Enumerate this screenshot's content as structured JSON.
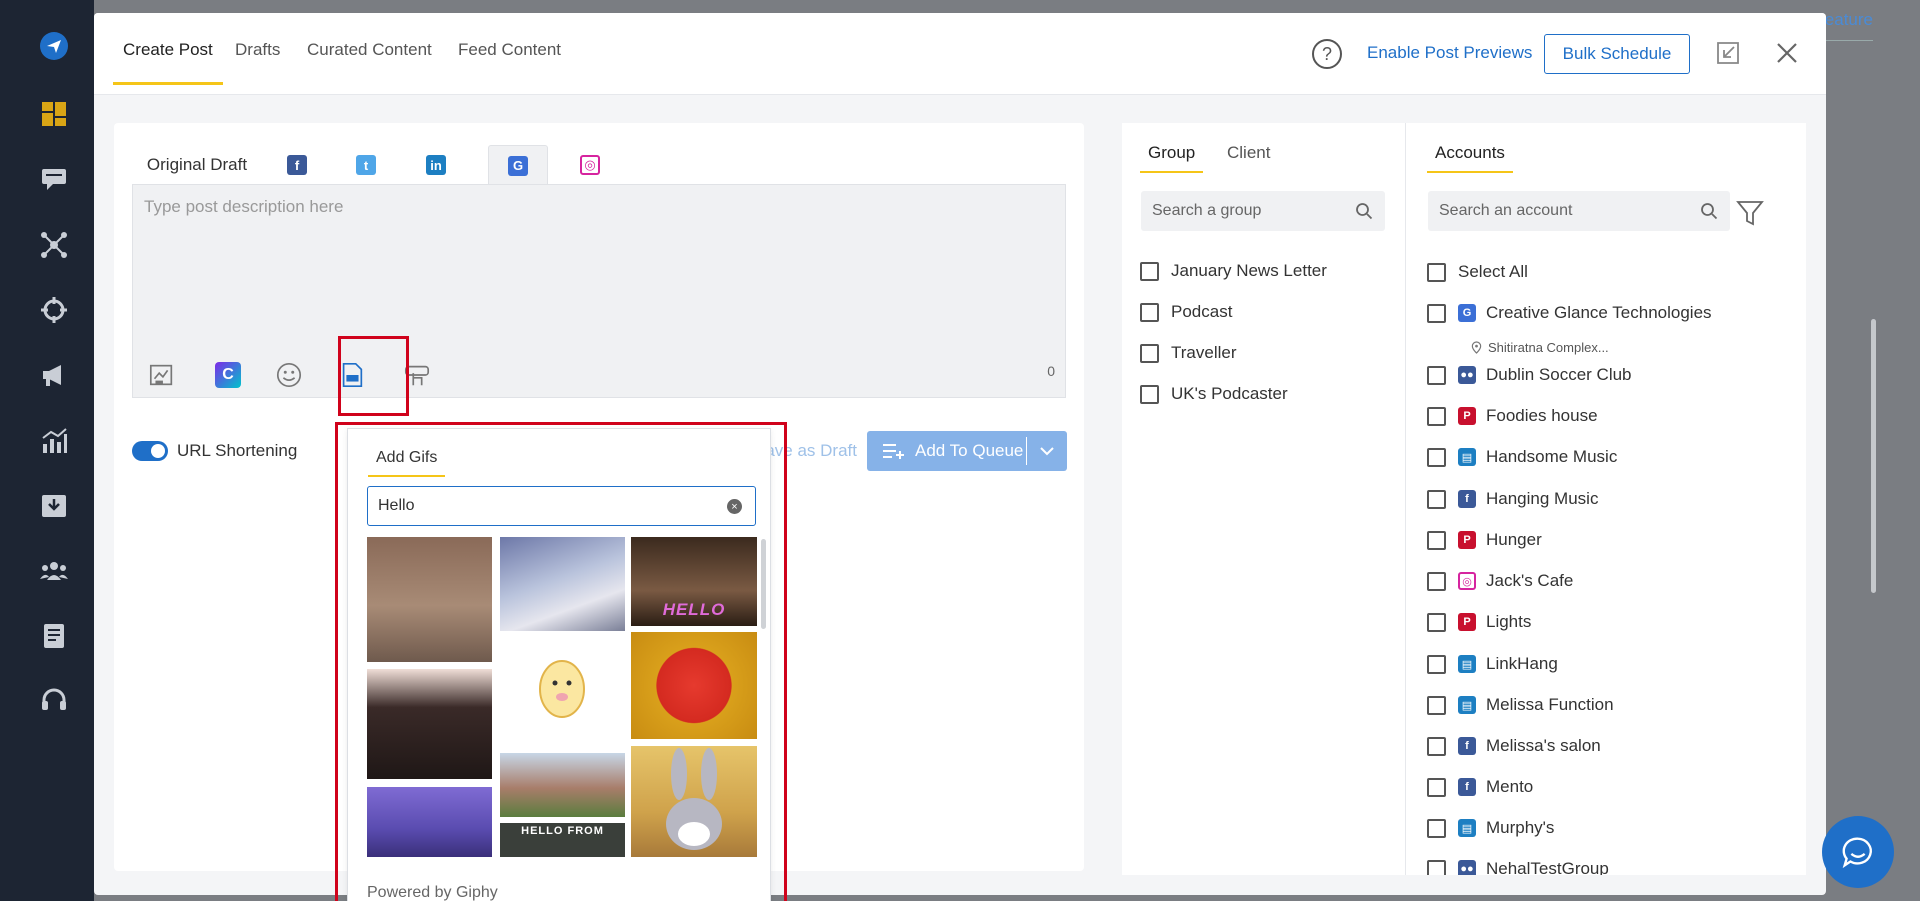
{
  "background": {
    "feature_text": "eature"
  },
  "header": {
    "tabs": [
      {
        "label": "Create Post"
      },
      {
        "label": "Drafts"
      },
      {
        "label": "Curated Content"
      },
      {
        "label": "Feed Content"
      }
    ],
    "help_icon": "?",
    "enable_previews": "Enable Post Previews",
    "bulk_schedule": "Bulk Schedule"
  },
  "editor": {
    "original_tab": "Original Draft",
    "platform_icons": [
      "facebook-icon",
      "twitter-icon",
      "linkedin-icon",
      "google-business-icon",
      "instagram-icon"
    ],
    "placeholder": "Type post description here",
    "char_count": "0",
    "url_shortening": "URL Shortening",
    "url_shortening_on": true,
    "save_draft": "Save as Draft",
    "add_to_queue": "Add To Queue"
  },
  "gif_popup": {
    "tab": "Add Gifs",
    "search_value": "Hello",
    "captions": [
      "HELLO",
      "HELLO FROM"
    ],
    "powered_by": "Powered by Giphy"
  },
  "groups": {
    "tabs": [
      {
        "label": "Group"
      },
      {
        "label": "Client"
      }
    ],
    "search_placeholder": "Search a group",
    "items": [
      {
        "label": "January News Letter"
      },
      {
        "label": "Podcast"
      },
      {
        "label": "Traveller"
      },
      {
        "label": "UK's Podcaster"
      }
    ]
  },
  "accounts": {
    "tab": "Accounts",
    "search_placeholder": "Search an account",
    "select_all": "Select All",
    "items": [
      {
        "label": "Creative Glance Technologies",
        "sub": "Shitiratna Complex...",
        "icon": "google-business-icon",
        "color": "#3b6fd6"
      },
      {
        "label": "Dublin Soccer Club",
        "icon": "facebook-group-icon",
        "color": "#3b5998"
      },
      {
        "label": "Foodies house",
        "icon": "pinterest-icon",
        "color": "#c8102e"
      },
      {
        "label": "Handsome Music",
        "icon": "linkedin-page-icon",
        "color": "#1d7fc2"
      },
      {
        "label": "Hanging Music",
        "icon": "facebook-icon",
        "color": "#3b5998"
      },
      {
        "label": "Hunger",
        "icon": "pinterest-icon",
        "color": "#c8102e"
      },
      {
        "label": "Jack's Cafe",
        "icon": "instagram-icon",
        "color": "#d6249f"
      },
      {
        "label": "Lights",
        "icon": "pinterest-icon",
        "color": "#c8102e"
      },
      {
        "label": "LinkHang",
        "icon": "linkedin-page-icon",
        "color": "#1d7fc2"
      },
      {
        "label": "Melissa Function",
        "icon": "linkedin-page-icon",
        "color": "#1d7fc2"
      },
      {
        "label": "Melissa's salon",
        "icon": "facebook-icon",
        "color": "#3b5998"
      },
      {
        "label": "Mento",
        "icon": "facebook-icon",
        "color": "#3b5998"
      },
      {
        "label": "Murphy's",
        "icon": "linkedin-page-icon",
        "color": "#1d7fc2"
      },
      {
        "label": "NehalTestGroup",
        "icon": "facebook-group-icon",
        "color": "#3b5998"
      }
    ]
  },
  "colors": {
    "accent": "#1f6fc8",
    "tab_underline": "#f5c518",
    "highlight": "#d0021b",
    "nav_bg": "#1d2533"
  }
}
